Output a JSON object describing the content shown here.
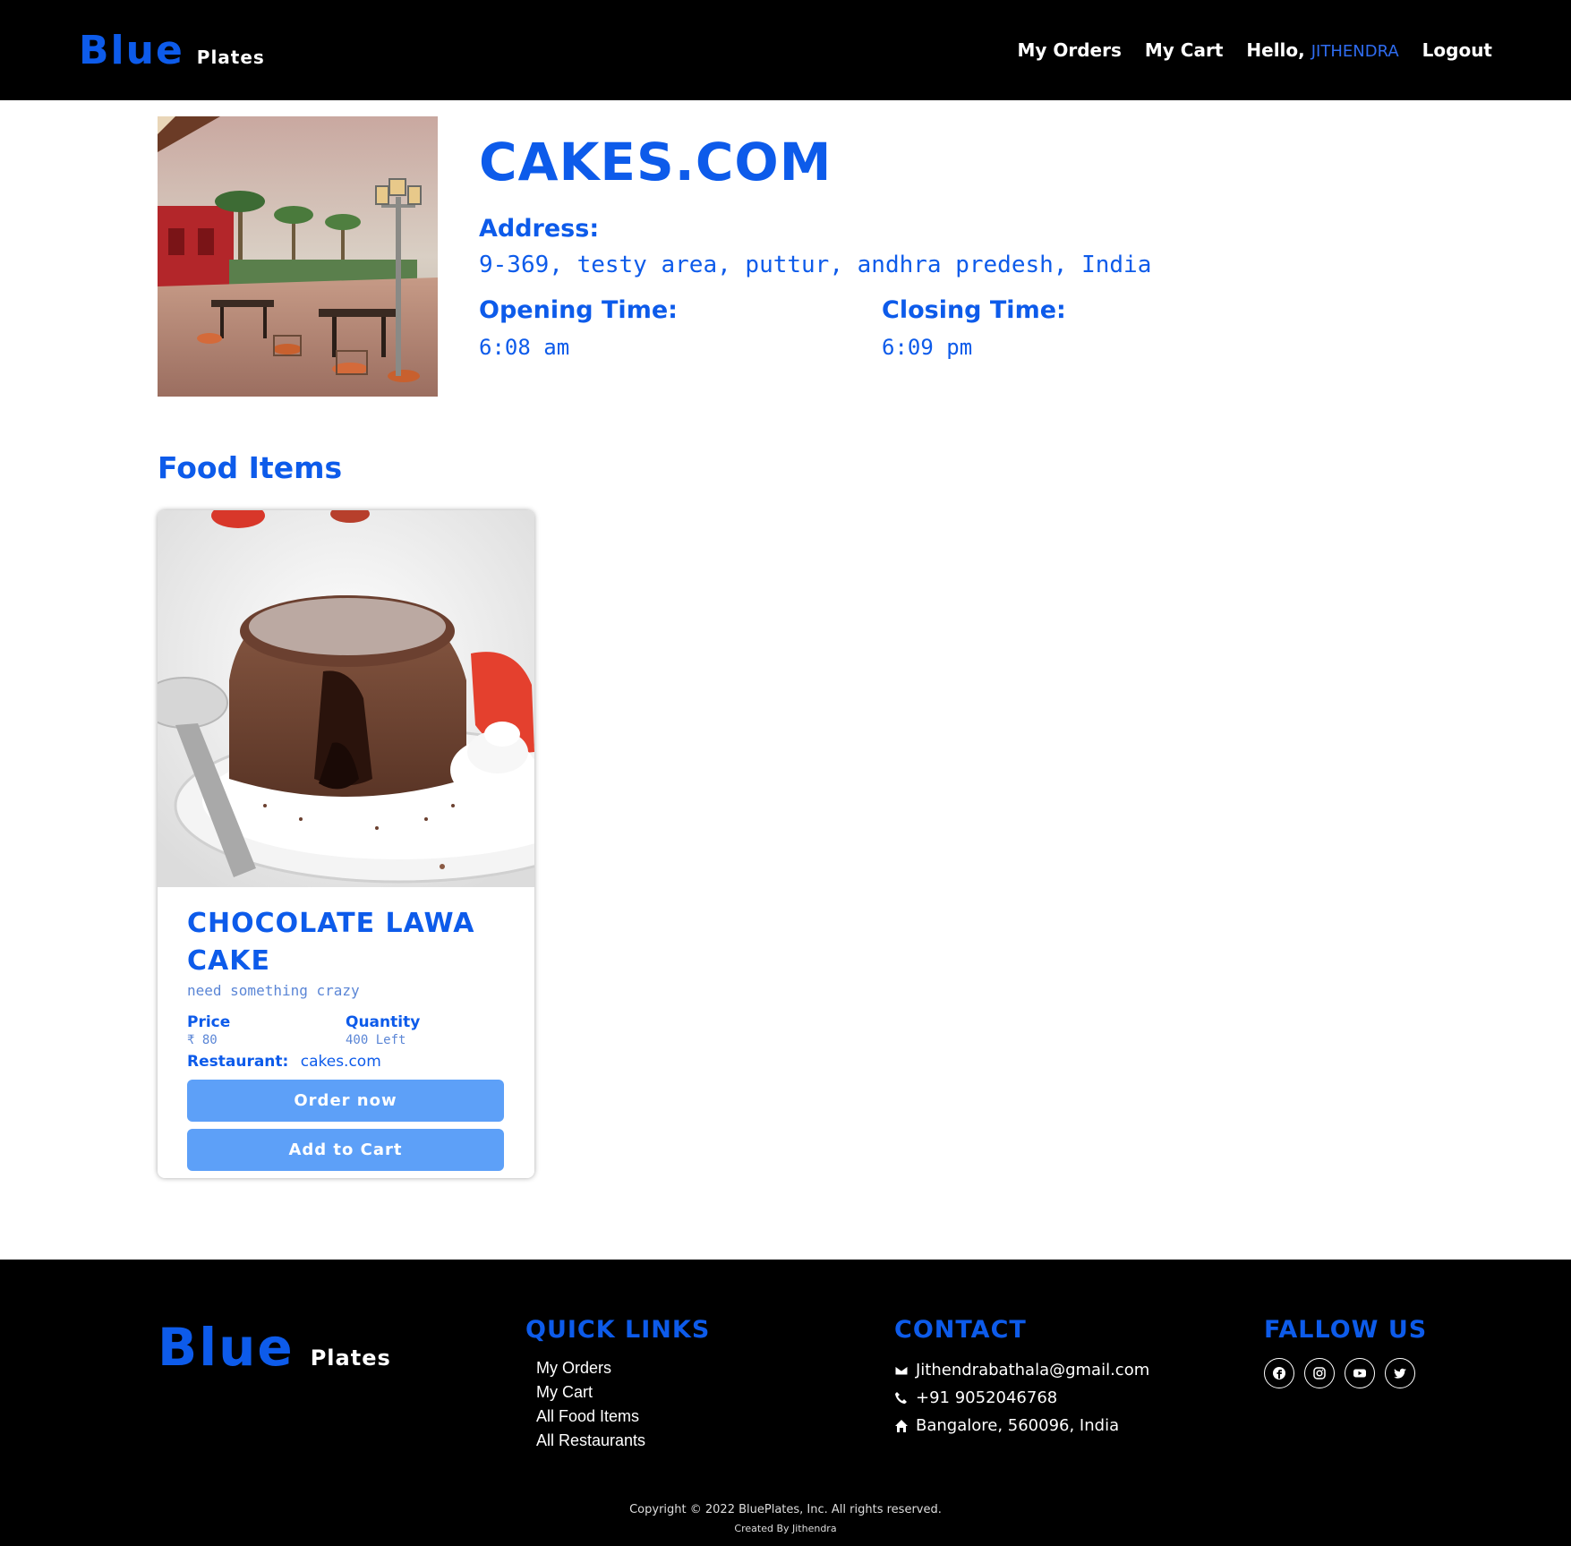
{
  "header": {
    "brand_main": "Blue",
    "brand_sub": "Plates",
    "nav": {
      "my_orders": "My Orders",
      "my_cart": "My Cart",
      "hello": "Hello,",
      "username": "JITHENDRA",
      "logout": "Logout"
    }
  },
  "restaurant": {
    "name": "CAKES.COM",
    "address_label": "Address:",
    "address": "9-369, testy area, puttur, andhra predesh, India",
    "opening_label": "Opening Time:",
    "opening_time": "6:08 am",
    "closing_label": "Closing Time:",
    "closing_time": "6:09 pm"
  },
  "food_section": {
    "title": "Food Items",
    "items": [
      {
        "name": "CHOCOLATE LAWA CAKE",
        "description": "need something crazy",
        "price_label": "Price",
        "price": "₹ 80",
        "quantity_label": "Quantity",
        "quantity": "400 Left",
        "restaurant_label": "Restaurant:",
        "restaurant": "cakes.com",
        "order_button": "Order now",
        "cart_button": "Add to Cart"
      }
    ]
  },
  "footer": {
    "brand_main": "Blue",
    "brand_sub": "Plates",
    "quick_links_title": "QUICK LINKS",
    "quick_links": [
      "My Orders",
      "My Cart",
      "All Food Items",
      "All Restaurants"
    ],
    "contact_title": "CONTACT",
    "email": "Jithendrabathala@gmail.com",
    "phone": "+91 9052046768",
    "location": "Bangalore, 560096, India",
    "follow_title": "FALLOW US",
    "social_icons": [
      "facebook-icon",
      "instagram-icon",
      "youtube-icon",
      "twitter-icon"
    ],
    "copyright": "Copyright © 2022 BluePlates, Inc. All rights reserved.",
    "created_by": "Created By Jithendra"
  },
  "colors": {
    "accent": "#0d5bea",
    "button": "#5da0f8",
    "header_bg": "#000000"
  }
}
